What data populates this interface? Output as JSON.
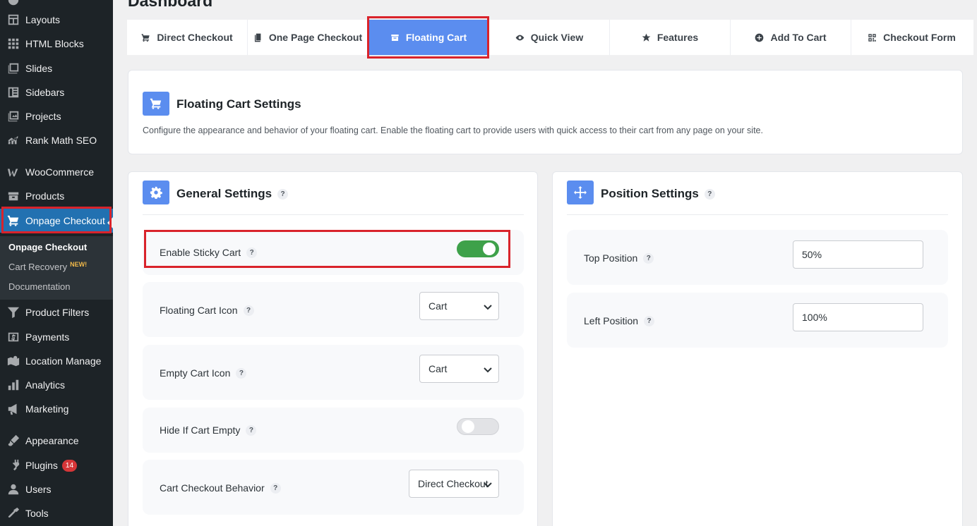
{
  "page": {
    "title": "Dashboard"
  },
  "sidebar": {
    "items": [
      {
        "label": "Layouts",
        "icon": "layouts-icon"
      },
      {
        "label": "HTML Blocks",
        "icon": "html-blocks-icon"
      },
      {
        "label": "Slides",
        "icon": "slides-icon"
      },
      {
        "label": "Sidebars",
        "icon": "sidebars-icon"
      },
      {
        "label": "Projects",
        "icon": "projects-icon"
      },
      {
        "label": "Rank Math SEO",
        "icon": "rank-math-icon"
      },
      {
        "label": "WooCommerce",
        "icon": "woocommerce-icon"
      },
      {
        "label": "Products",
        "icon": "products-icon"
      },
      {
        "label": "Onpage Checkout",
        "icon": "cart-icon"
      },
      {
        "label": "Product Filters",
        "icon": "filter-icon"
      },
      {
        "label": "Payments",
        "icon": "payments-icon"
      },
      {
        "label": "Location Manage",
        "icon": "location-icon"
      },
      {
        "label": "Analytics",
        "icon": "analytics-icon"
      },
      {
        "label": "Marketing",
        "icon": "marketing-icon"
      },
      {
        "label": "Appearance",
        "icon": "appearance-icon"
      },
      {
        "label": "Plugins",
        "icon": "plugins-icon",
        "badge": "14"
      },
      {
        "label": "Users",
        "icon": "users-icon"
      },
      {
        "label": "Tools",
        "icon": "tools-icon"
      }
    ],
    "submenu": [
      {
        "label": "Onpage Checkout"
      },
      {
        "label": "Cart Recovery",
        "badge": "NEW!"
      },
      {
        "label": "Documentation"
      }
    ]
  },
  "tabs": [
    {
      "label": "Direct Checkout",
      "icon": "cart-icon"
    },
    {
      "label": "One Page Checkout",
      "icon": "pages-icon"
    },
    {
      "label": "Floating Cart",
      "icon": "floating-cart-icon"
    },
    {
      "label": "Quick View",
      "icon": "eye-icon"
    },
    {
      "label": "Features",
      "icon": "star-icon"
    },
    {
      "label": "Add To Cart",
      "icon": "plus-circle-icon"
    },
    {
      "label": "Checkout Form",
      "icon": "form-icon"
    }
  ],
  "header_card": {
    "title": "Floating Cart Settings",
    "description": "Configure the appearance and behavior of your floating cart. Enable the floating cart to provide users with quick access to their cart from any page on your site."
  },
  "general": {
    "title": "General Settings",
    "help": "?",
    "enable_sticky_cart": {
      "label": "Enable Sticky Cart",
      "on": true
    },
    "floating_cart_icon": {
      "label": "Floating Cart Icon",
      "value": "Cart"
    },
    "empty_cart_icon": {
      "label": "Empty Cart Icon",
      "value": "Cart"
    },
    "hide_if_empty": {
      "label": "Hide If Cart Empty",
      "on": false
    },
    "checkout_behavior": {
      "label": "Cart Checkout Behavior",
      "value": "Direct Checkout"
    }
  },
  "position": {
    "title": "Position Settings",
    "help": "?",
    "top": {
      "label": "Top Position",
      "value": "50%"
    },
    "left": {
      "label": "Left Position",
      "value": "100%"
    }
  },
  "colors": {
    "accent": "#5b8def",
    "toggle_on": "#3ea14a",
    "highlight": "#d9232b",
    "sidebar": "#1d2327",
    "wp_blue": "#2271b1"
  }
}
